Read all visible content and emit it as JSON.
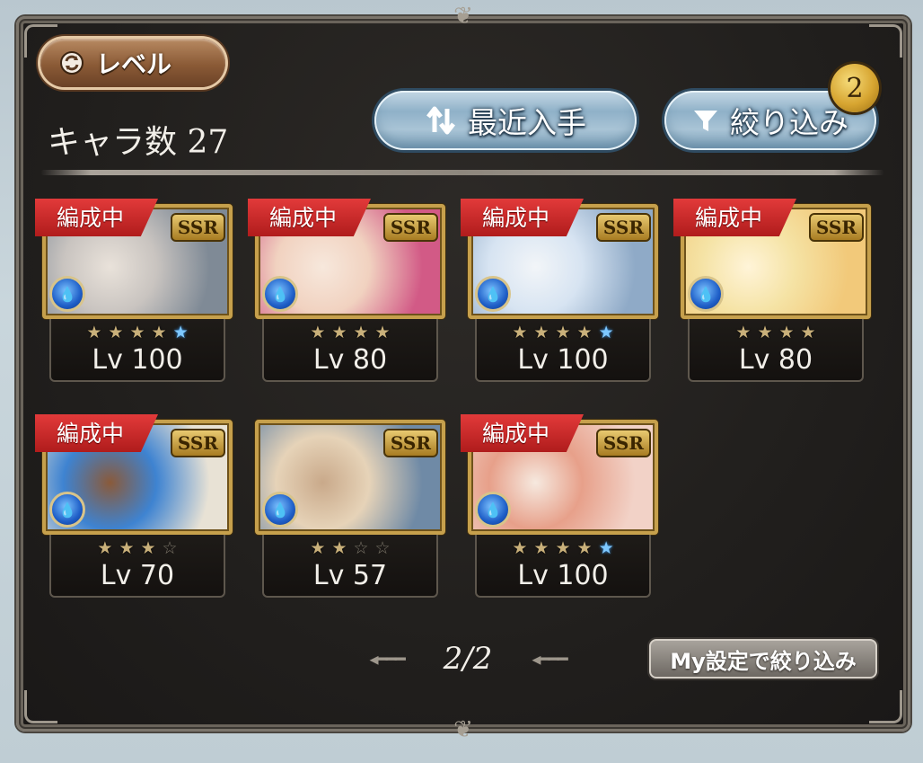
{
  "header": {
    "level_button_label": "レベル",
    "count_label": "キャラ数",
    "count_value": "27",
    "sort_button_label": "最近入手",
    "filter_button_label": "絞り込み",
    "filter_badge_count": "2"
  },
  "cards": [
    {
      "tag": "編成中",
      "rarity": "SSR",
      "level": "Lv 100",
      "uncap_stars": 4,
      "blue_star": true,
      "max_stars": 5,
      "portrait_colors": [
        "#c9c4c0",
        "#7f8a96",
        "#e9e2da"
      ]
    },
    {
      "tag": "編成中",
      "rarity": "SSR",
      "level": "Lv 80",
      "uncap_stars": 4,
      "blue_star": false,
      "max_stars": 4,
      "portrait_colors": [
        "#f1d2c0",
        "#d25a86",
        "#f7e8dc"
      ]
    },
    {
      "tag": "編成中",
      "rarity": "SSR",
      "level": "Lv 100",
      "uncap_stars": 4,
      "blue_star": true,
      "max_stars": 5,
      "portrait_colors": [
        "#d7e4f2",
        "#8faac7",
        "#f2f5f8"
      ]
    },
    {
      "tag": "編成中",
      "rarity": "SSR",
      "level": "Lv 80",
      "uncap_stars": 4,
      "blue_star": false,
      "max_stars": 4,
      "portrait_colors": [
        "#f5e3a5",
        "#f2c97a",
        "#fff4d8"
      ]
    },
    {
      "tag": "編成中",
      "rarity": "SSR",
      "level": "Lv 70",
      "uncap_stars": 3,
      "blue_star": false,
      "max_stars": 4,
      "portrait_colors": [
        "#3e83d1",
        "#e8e2d5",
        "#8a5a3a"
      ]
    },
    {
      "tag": "",
      "rarity": "SSR",
      "level": "Lv 57",
      "uncap_stars": 2,
      "blue_star": false,
      "max_stars": 4,
      "portrait_colors": [
        "#e6d3b8",
        "#6f8aa6",
        "#c9a98a"
      ]
    },
    {
      "tag": "編成中",
      "rarity": "SSR",
      "level": "Lv 100",
      "uncap_stars": 4,
      "blue_star": true,
      "max_stars": 5,
      "portrait_colors": [
        "#e7a08a",
        "#f2d2c7",
        "#f6e9df"
      ]
    }
  ],
  "pagination": {
    "page": "2/2"
  },
  "my_settings_filter_label": "My設定で絞り込み",
  "icons": {
    "level_toggle": "cycle-icon",
    "sort": "sort-arrows-icon",
    "filter": "funnel-icon",
    "element": "water-element-icon"
  },
  "colors": {
    "tag_red": "#c72525",
    "gold_frame": "#c6a04c",
    "button_blue": "#8fb1c8",
    "level_button_brown": "#8a5a36"
  }
}
